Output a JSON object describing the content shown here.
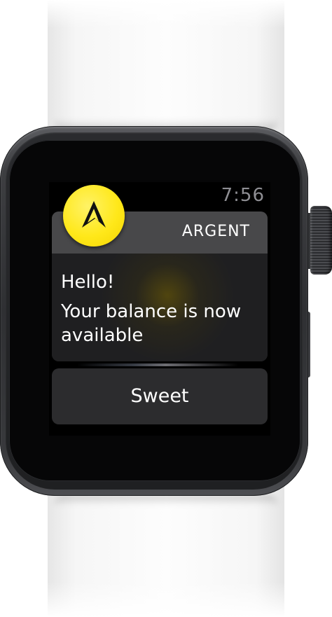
{
  "status_bar": {
    "time": "7:56"
  },
  "notification": {
    "app_name": "ARGENT",
    "app_icon": "argent-logo-icon",
    "title": "Hello!",
    "message": "Your balance is now available"
  },
  "actions": [
    {
      "label": "Sweet"
    }
  ],
  "colors": {
    "icon_yellow": "#ffe81a",
    "card": "#2c2c2e",
    "card_header": "#48484a",
    "time_gray": "#8e8e93"
  }
}
